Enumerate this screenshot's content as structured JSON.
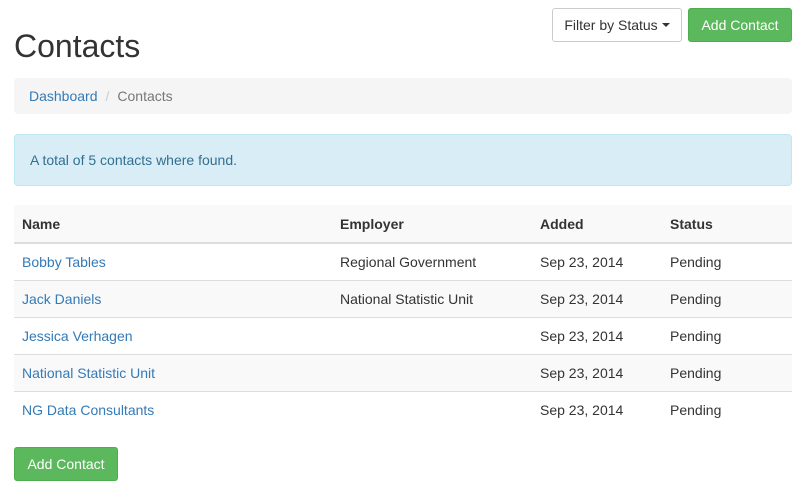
{
  "header": {
    "title": "Contacts",
    "filter_label": "Filter by Status",
    "add_label": "Add Contact"
  },
  "breadcrumb": {
    "items": [
      "Dashboard",
      "Contacts"
    ],
    "separator": "/"
  },
  "alert": {
    "text": "A total of 5 contacts where found."
  },
  "table": {
    "columns": [
      "Name",
      "Employer",
      "Added",
      "Status"
    ],
    "rows": [
      {
        "name": "Bobby Tables",
        "employer": "Regional Government",
        "added": "Sep 23, 2014",
        "status": "Pending"
      },
      {
        "name": "Jack Daniels",
        "employer": "National Statistic Unit",
        "added": "Sep 23, 2014",
        "status": "Pending"
      },
      {
        "name": "Jessica Verhagen",
        "employer": "",
        "added": "Sep 23, 2014",
        "status": "Pending"
      },
      {
        "name": "National Statistic Unit",
        "employer": "",
        "added": "Sep 23, 2014",
        "status": "Pending"
      },
      {
        "name": "NG Data Consultants",
        "employer": "",
        "added": "Sep 23, 2014",
        "status": "Pending"
      }
    ]
  },
  "footer": {
    "add_label": "Add Contact"
  },
  "colors": {
    "success": "#5cb85c",
    "link": "#337ab7",
    "info_bg": "#d9edf7",
    "info_text": "#31708f"
  }
}
